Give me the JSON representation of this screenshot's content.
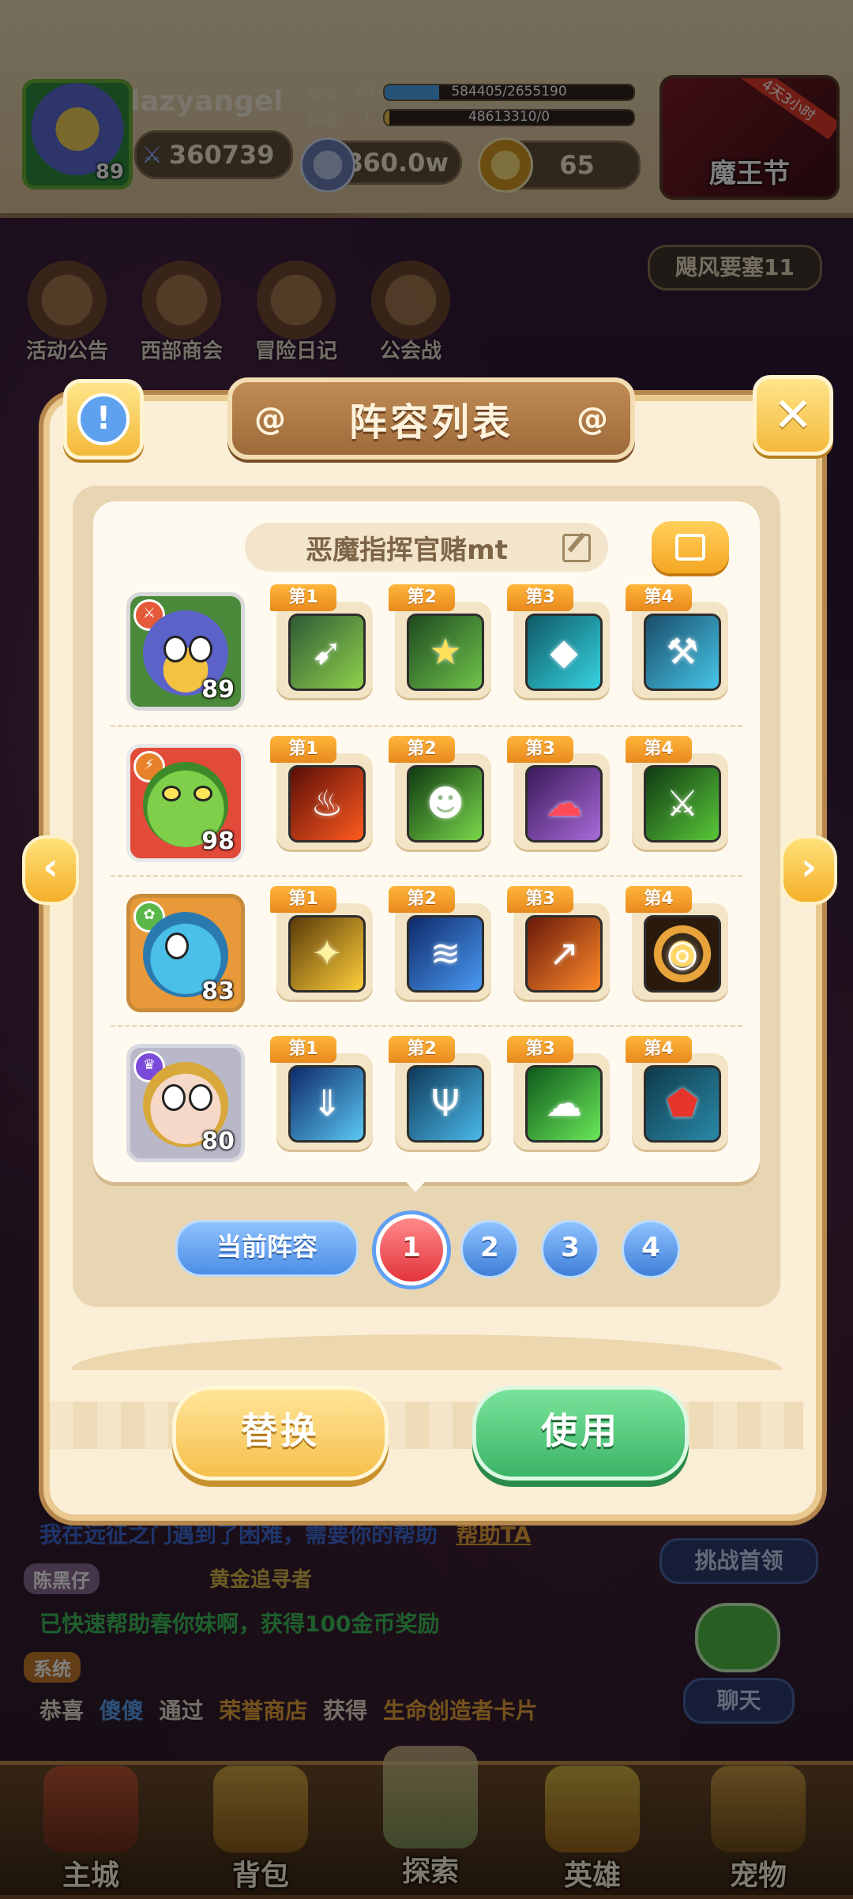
{
  "player": {
    "name": "lazyangel",
    "avatar_level": "89",
    "power": "360739",
    "level_label": "等级",
    "level": "89",
    "xp_text": "584405/2655190",
    "xp_fraction": 0.22,
    "breakthrough_label": "突破",
    "breakthrough": "1",
    "breakthrough_text": "48613310/0"
  },
  "currency": {
    "coins": "7860.0w",
    "gems": "65"
  },
  "event": {
    "label": "魔王节",
    "timer": "4天3小时"
  },
  "menu": [
    {
      "label": "活动公告"
    },
    {
      "label": "西部商会"
    },
    {
      "label": "冒险日记"
    },
    {
      "label": "公会战"
    }
  ],
  "map_label": "飓风要塞11",
  "side": {
    "challenge": "挑战首领",
    "chat": "聊天"
  },
  "chat": {
    "line1_text": "我在远征之门遇到了困难，需要你的帮助",
    "line1_link": "帮助TA",
    "speaker": "陈黑仔",
    "speaker_title": "黄金追寻者",
    "line2_text": "已快速帮助春你妹啊，获得100金币奖励",
    "system_tag": "系统",
    "line3_a": "恭喜",
    "line3_name": "傻傻",
    "line3_b": "通过",
    "line3_shop": "荣誉商店",
    "line3_c": "获得",
    "line3_item": "生命创造者卡片"
  },
  "nav": [
    {
      "label": "主城"
    },
    {
      "label": "背包"
    },
    {
      "label": "探索"
    },
    {
      "label": "英雄"
    },
    {
      "label": "宠物"
    }
  ],
  "modal": {
    "title": "阵容列表",
    "lineup_name": "恶魔指挥官赌mt",
    "rows": [
      {
        "hero_level": "89",
        "skills": [
          {
            "tag": "第1",
            "icon": "arrow-strike-icon"
          },
          {
            "tag": "第2",
            "icon": "star-shield-icon"
          },
          {
            "tag": "第3",
            "icon": "shadow-beast-icon"
          },
          {
            "tag": "第4",
            "icon": "hammer-icon"
          }
        ]
      },
      {
        "hero_level": "98",
        "skills": [
          {
            "tag": "第1",
            "icon": "fire-demon-icon"
          },
          {
            "tag": "第2",
            "icon": "goblin-icon"
          },
          {
            "tag": "第3",
            "icon": "purple-ghost-icon"
          },
          {
            "tag": "第4",
            "icon": "green-slash-icon"
          }
        ]
      },
      {
        "hero_level": "83",
        "skills": [
          {
            "tag": "第1",
            "icon": "golden-stars-icon"
          },
          {
            "tag": "第2",
            "icon": "water-splash-icon"
          },
          {
            "tag": "第3",
            "icon": "fire-spear-icon"
          },
          {
            "tag": "第4",
            "icon": "target-icon"
          }
        ]
      },
      {
        "hero_level": "80",
        "skills": [
          {
            "tag": "第1",
            "icon": "ice-sword-icon"
          },
          {
            "tag": "第2",
            "icon": "trident-icon"
          },
          {
            "tag": "第3",
            "icon": "poison-cloud-icon"
          },
          {
            "tag": "第4",
            "icon": "red-mask-icon"
          }
        ]
      }
    ],
    "current_label": "当前阵容",
    "slots": [
      "1",
      "2",
      "3",
      "4"
    ],
    "active_slot": "1",
    "replace_label": "替换",
    "use_label": "使用"
  },
  "colors": {
    "accent_gold": "#f4b93a",
    "use_green": "#3cb567",
    "slot_blue": "#4c8ee6",
    "active_red": "#e3343b"
  }
}
